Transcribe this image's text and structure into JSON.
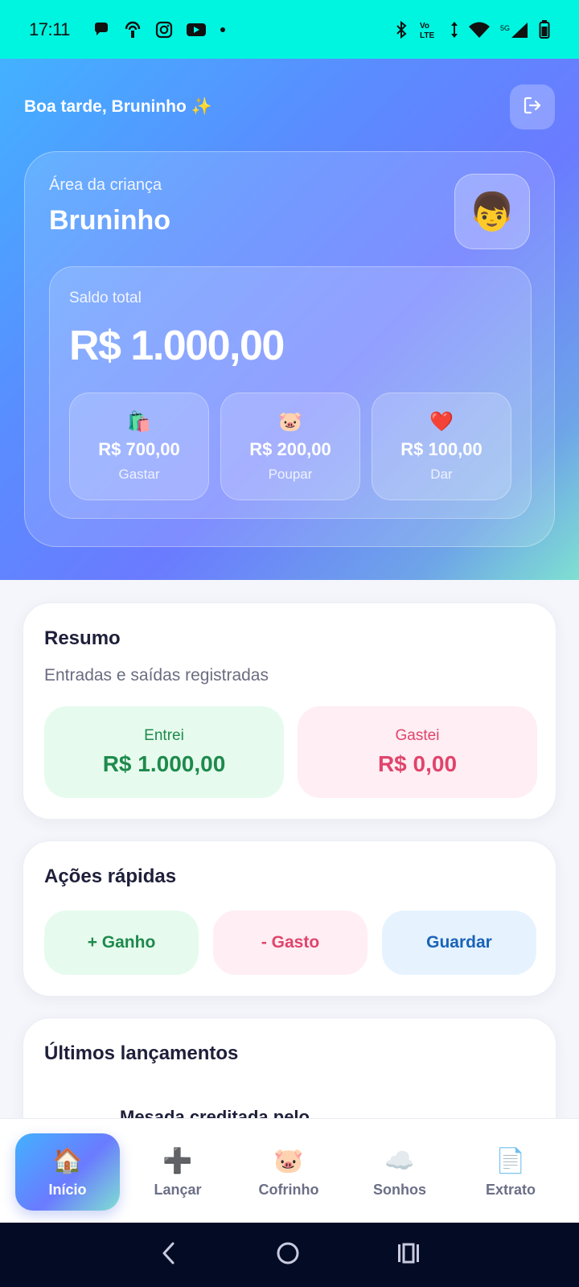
{
  "status_bar": {
    "time": "17:11",
    "network": "5G",
    "volte": "Vo LTE"
  },
  "header": {
    "greeting": "Boa tarde, Bruninho ✨"
  },
  "profile": {
    "area_label": "Área da criança",
    "name": "Bruninho",
    "avatar_emoji": "👦"
  },
  "balance": {
    "label": "Saldo total",
    "value": "R$ 1.000,00",
    "jars": [
      {
        "emoji": "🛍️",
        "value": "R$ 700,00",
        "label": "Gastar"
      },
      {
        "emoji": "🐷",
        "value": "R$ 200,00",
        "label": "Poupar"
      },
      {
        "emoji": "❤️",
        "value": "R$ 100,00",
        "label": "Dar"
      }
    ]
  },
  "summary": {
    "title": "Resumo",
    "subtitle": "Entradas e saídas registradas",
    "in_label": "Entrei",
    "in_value": "R$ 1.000,00",
    "out_label": "Gastei",
    "out_value": "R$ 0,00"
  },
  "quick_actions": {
    "title": "Ações rápidas",
    "gain": "+ Ganho",
    "spend": "- Gasto",
    "save": "Guardar"
  },
  "latest": {
    "title": "Últimos lançamentos",
    "items": [
      {
        "title": "Mesada creditada pelo"
      }
    ]
  },
  "bottom_nav": [
    {
      "icon": "🏠",
      "label": "Início",
      "active": true
    },
    {
      "icon": "➕",
      "label": "Lançar"
    },
    {
      "icon": "🐷",
      "label": "Cofrinho"
    },
    {
      "icon": "☁️",
      "label": "Sonhos"
    },
    {
      "icon": "📄",
      "label": "Extrato"
    }
  ],
  "colors": {
    "status_bar": "#00f5e0",
    "gain": "#1e8a4c",
    "spend": "#e0446c",
    "save": "#1a63b8"
  }
}
